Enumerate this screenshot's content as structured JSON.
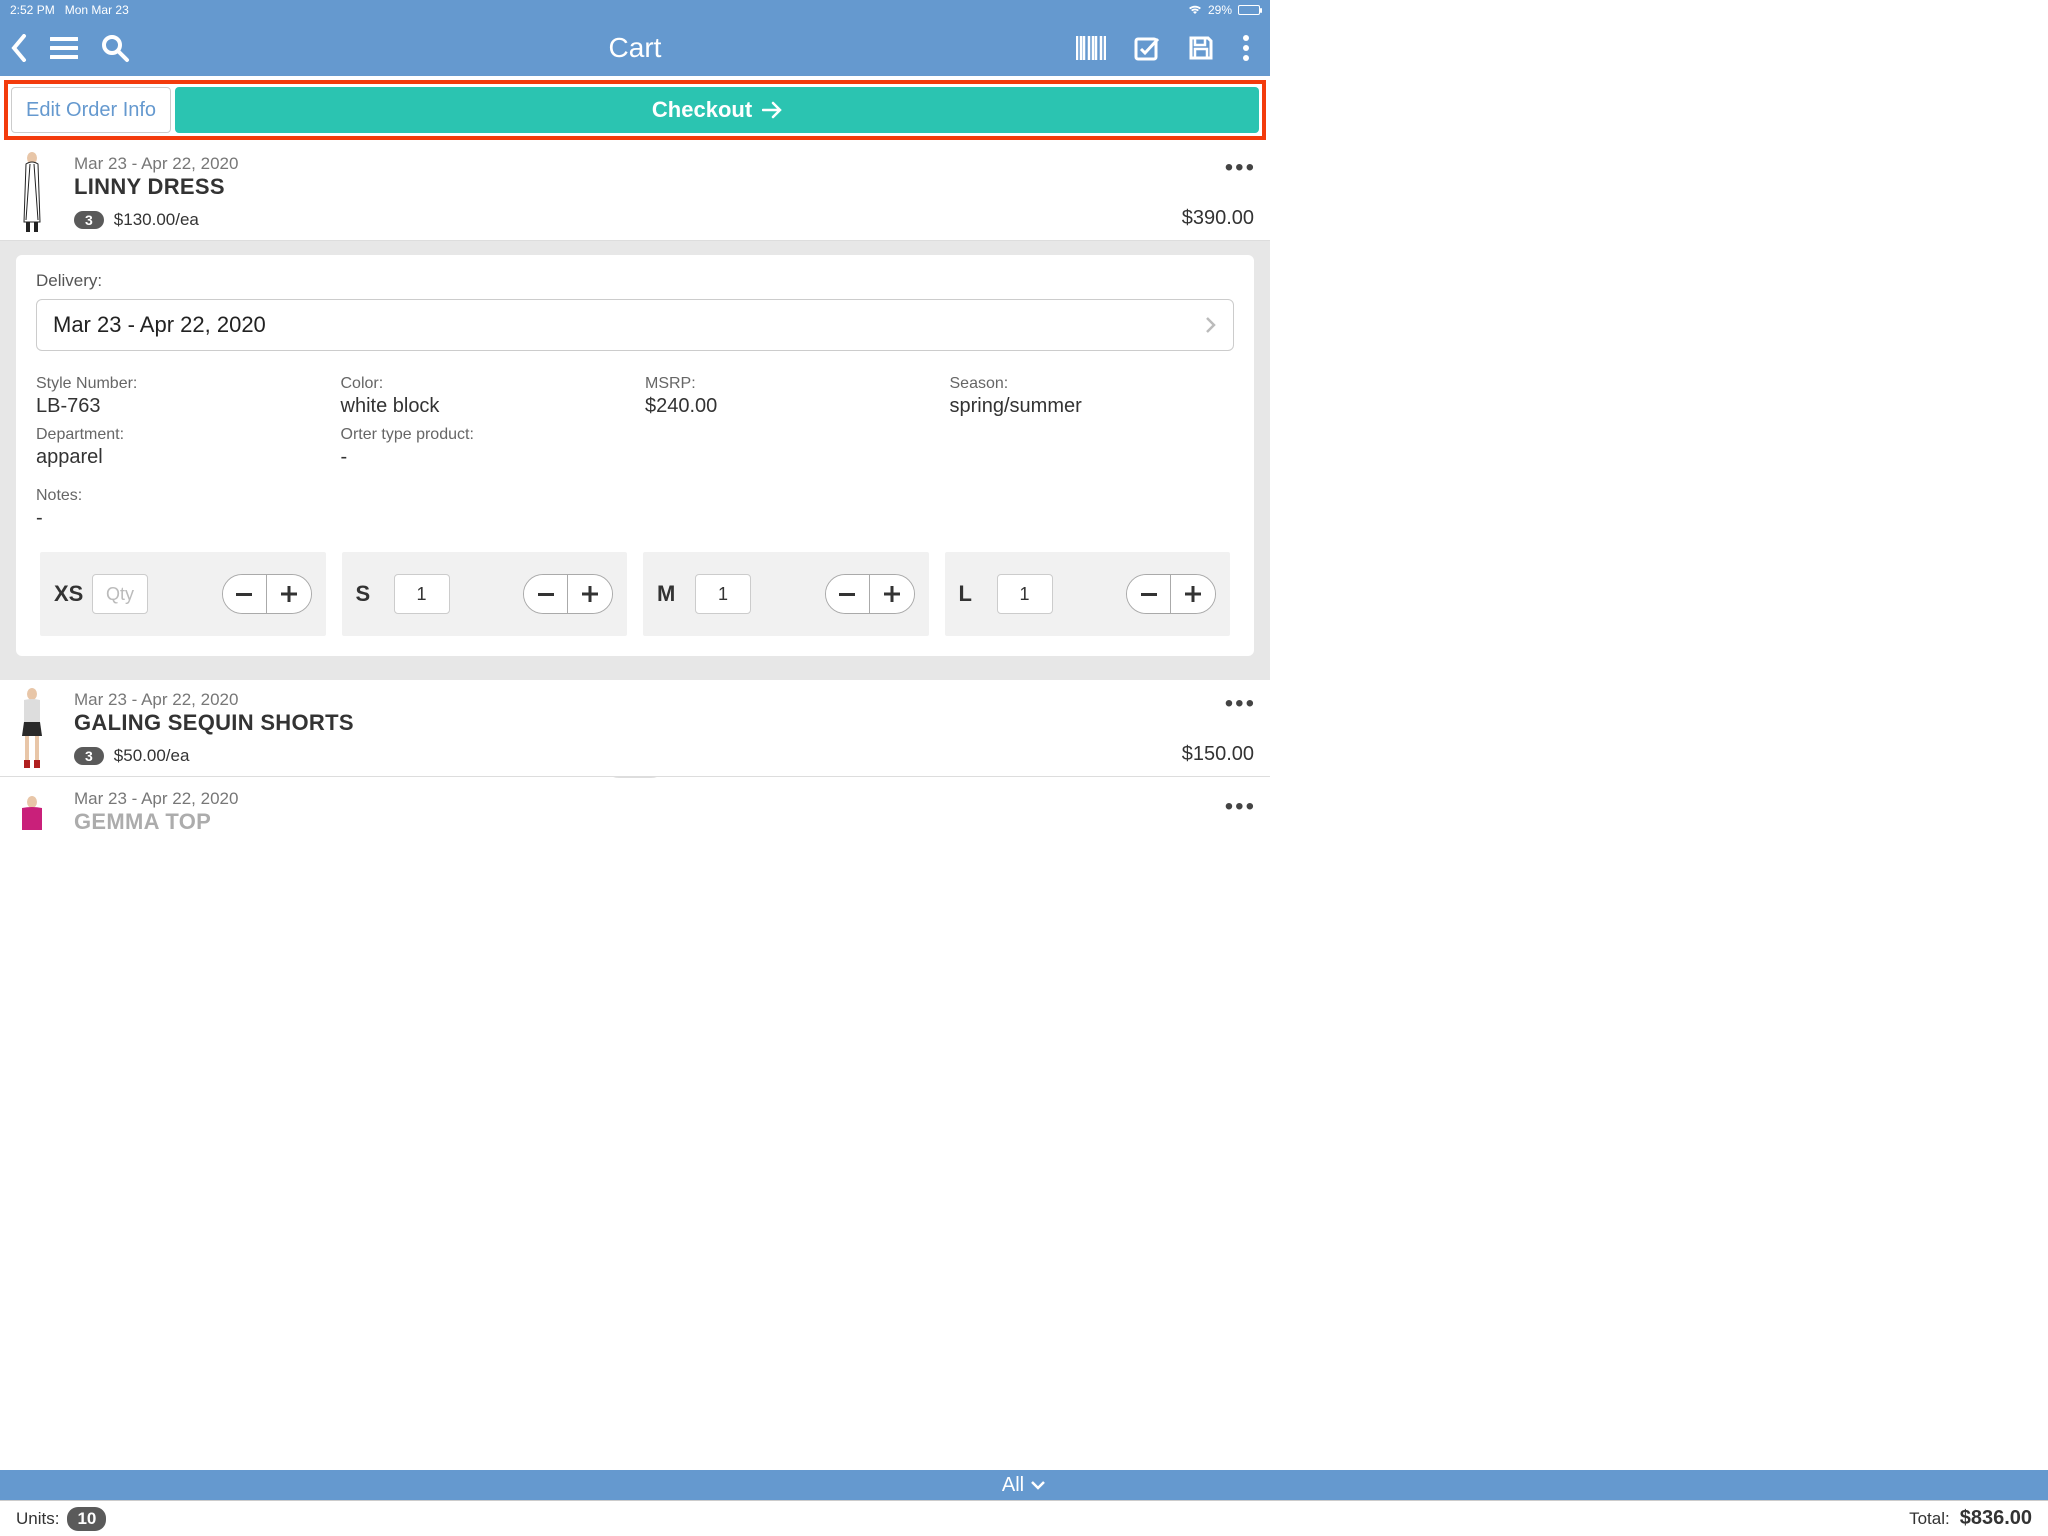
{
  "status": {
    "time": "2:52 PM",
    "date": "Mon Mar 23",
    "battery": "29%"
  },
  "header": {
    "title": "Cart"
  },
  "actions": {
    "edit": "Edit Order Info",
    "checkout": "Checkout"
  },
  "products": [
    {
      "dates": "Mar 23 - Apr 22, 2020",
      "name": "LINNY DRESS",
      "qty": "3",
      "price_each": "$130.00/ea",
      "total": "$390.00"
    },
    {
      "dates": "Mar 23 - Apr 22, 2020",
      "name": "GALING SEQUIN SHORTS",
      "qty": "3",
      "price_each": "$50.00/ea",
      "total": "$150.00"
    },
    {
      "dates": "Mar 23 - Apr 22, 2020",
      "name": "GEMMA TOP"
    }
  ],
  "details": {
    "delivery_label": "Delivery:",
    "delivery_value": "Mar 23 - Apr 22, 2020",
    "style_label": "Style Number:",
    "style_value": "LB-763",
    "color_label": "Color:",
    "color_value": "white block",
    "msrp_label": "MSRP:",
    "msrp_value": "$240.00",
    "season_label": "Season:",
    "season_value": "spring/summer",
    "dept_label": "Department:",
    "dept_value": "apparel",
    "otype_label": "Orter type product:",
    "otype_value": "-",
    "notes_label": "Notes:",
    "notes_value": "-"
  },
  "sizes": {
    "xs": {
      "label": "XS",
      "placeholder": "Qty"
    },
    "s": {
      "label": "S",
      "value": "1"
    },
    "m": {
      "label": "M",
      "value": "1"
    },
    "l": {
      "label": "L",
      "value": "1"
    }
  },
  "filter": {
    "label": "All"
  },
  "footer": {
    "units_label": "Units:",
    "units": "10",
    "total_label": "Total:",
    "total": "$836.00"
  }
}
